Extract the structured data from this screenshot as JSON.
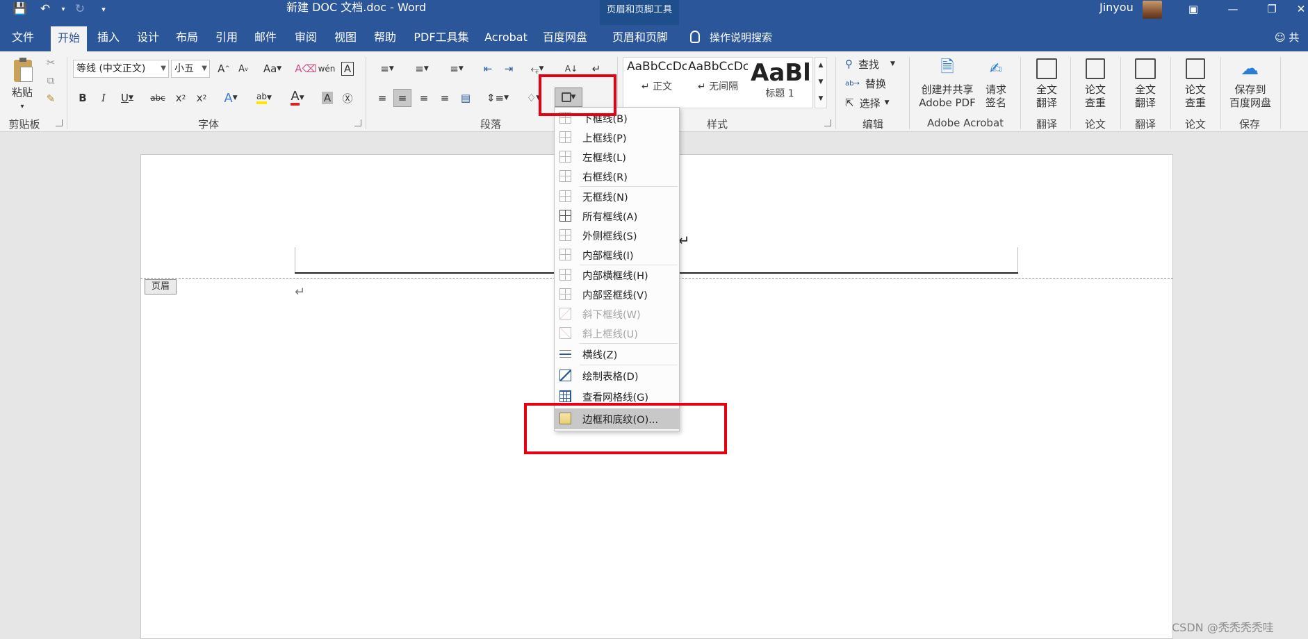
{
  "titlebar": {
    "doc_title": "新建 DOC 文档.doc  -  Word",
    "context_group": "页眉和页脚工具",
    "user": "Jinyou"
  },
  "tabs": [
    "文件",
    "开始",
    "插入",
    "设计",
    "布局",
    "引用",
    "邮件",
    "审阅",
    "视图",
    "帮助",
    "PDF工具集",
    "Acrobat",
    "百度网盘",
    "页眉和页脚"
  ],
  "active_tab": "开始",
  "tellme": "操作说明搜索",
  "share": "共享",
  "ribbon": {
    "clipboard": {
      "paste": "粘贴",
      "label": "剪贴板"
    },
    "font": {
      "name": "等线 (中文正文)",
      "size": "小五",
      "label": "字体"
    },
    "paragraph": {
      "label": "段落"
    },
    "styles": {
      "label": "样式",
      "items": [
        {
          "sample": "AaBbCcDc",
          "name": "↵ 正文"
        },
        {
          "sample": "AaBbCcDc",
          "name": "↵ 无间隔"
        },
        {
          "sample": "AaBl",
          "name": "标题 1"
        }
      ]
    },
    "editing": {
      "find": "查找",
      "replace": "替换",
      "select": "选择",
      "label": "编辑"
    },
    "acrobat": {
      "create": "创建并共享",
      "create2": "Adobe PDF",
      "sign": "请求",
      "sign2": "签名",
      "label": "Adobe Acrobat"
    },
    "translate1": {
      "l1": "全文",
      "l2": "翻译",
      "label": "翻译"
    },
    "paper1": {
      "l1": "论文",
      "l2": "查重",
      "label": "论文"
    },
    "translate2": {
      "l1": "全文",
      "l2": "翻译",
      "label": "翻译"
    },
    "paper2": {
      "l1": "论文",
      "l2": "查重",
      "label": "论文"
    },
    "save": {
      "l1": "保存到",
      "l2": "百度网盘",
      "label": "保存"
    }
  },
  "document": {
    "header_tag": "页眉",
    "header_text": "入]↵",
    "para_mark": "↵"
  },
  "border_menu": [
    {
      "label": "下框线(B)",
      "enabled": true
    },
    {
      "label": "上框线(P)",
      "enabled": true
    },
    {
      "label": "左框线(L)",
      "enabled": true
    },
    {
      "label": "右框线(R)",
      "enabled": true
    },
    {
      "label": "无框线(N)",
      "enabled": true
    },
    {
      "label": "所有框线(A)",
      "enabled": true
    },
    {
      "label": "外侧框线(S)",
      "enabled": true
    },
    {
      "label": "内部框线(I)",
      "enabled": true
    },
    {
      "label": "内部横框线(H)",
      "enabled": true
    },
    {
      "label": "内部竖框线(V)",
      "enabled": true
    },
    {
      "label": "斜下框线(W)",
      "enabled": false
    },
    {
      "label": "斜上框线(U)",
      "enabled": false
    },
    {
      "label": "横线(Z)",
      "enabled": true
    },
    {
      "label": "绘制表格(D)",
      "enabled": true
    },
    {
      "label": "查看网格线(G)",
      "enabled": true
    },
    {
      "label": "边框和底纹(O)...",
      "enabled": true,
      "highlighted": true
    }
  ],
  "watermark": "CSDN @秃秃秃秃哇",
  "colors": {
    "word_blue": "#2b579a",
    "highlight_red": "#e60012"
  }
}
